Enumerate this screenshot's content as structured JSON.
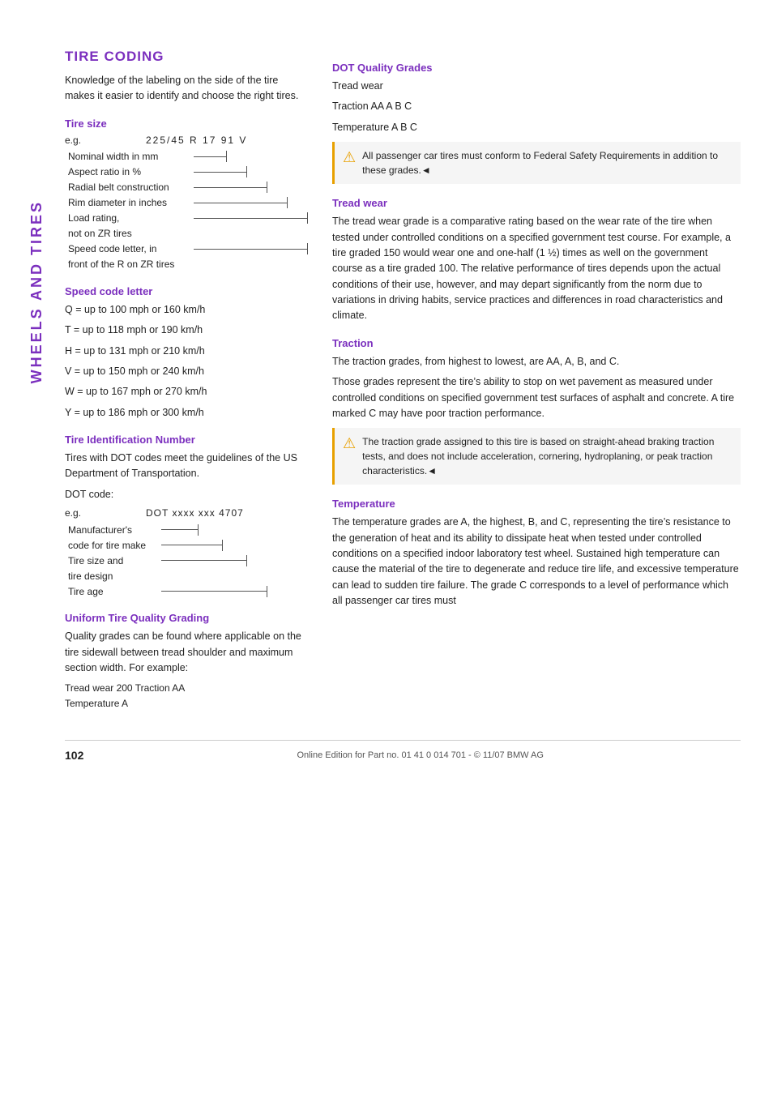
{
  "sidebar": {
    "label": "WHEELS AND TIRES"
  },
  "header": {
    "title": "TIRE CODING"
  },
  "intro": {
    "text": "Knowledge of the labeling on the side of the tire makes it easier to identify and choose the right tires."
  },
  "tire_size": {
    "title": "Tire size",
    "eg_label": "e.g.",
    "code": "225/45  R 17  91  V",
    "rows": [
      {
        "label": "Nominal width in mm",
        "lines": 1
      },
      {
        "label": "Aspect ratio in %",
        "lines": 2
      },
      {
        "label": "Radial belt construction",
        "lines": 3
      },
      {
        "label": "Rim diameter in inches",
        "lines": 4
      },
      {
        "label": "Load rating,",
        "lines": 5
      },
      {
        "label": "not on ZR tires",
        "lines": 5
      },
      {
        "label": "Speed code letter, in",
        "lines": 6
      },
      {
        "label": "front of the R on ZR tires",
        "lines": 6
      }
    ]
  },
  "speed_code": {
    "title": "Speed code letter",
    "items": [
      "Q = up to 100 mph or 160 km/h",
      "T = up to 118 mph or 190 km/h",
      "H = up to 131 mph or 210 km/h",
      "V = up to 150 mph or 240 km/h",
      "W = up to 167 mph or 270 km/h",
      "Y = up to 186 mph or 300 km/h"
    ]
  },
  "tire_id": {
    "title": "Tire Identification Number",
    "text1": "Tires with DOT codes meet the guidelines of the US Department of Transportation.",
    "dot_code_label": "DOT code:",
    "eg_label": "e.g.",
    "dot_code": "DOT xxxx xxx 4707",
    "dot_rows": [
      "Manufacturer’s",
      "code for tire make",
      "Tire size and",
      "tire design",
      "Tire age"
    ]
  },
  "uniform_tq": {
    "title": "Uniform Tire Quality Grading",
    "text": "Quality grades can be found where applicable on the tire sidewall between tread shoulder and maximum section width. For example:",
    "example": "Tread wear 200 Traction AA\nTemperature A"
  },
  "dot_quality": {
    "title": "DOT Quality Grades",
    "lines": [
      "Tread wear",
      "Traction AA A B C",
      "Temperature A B C"
    ],
    "warning": "All passenger car tires must conform to Federal Safety Requirements in addition to these grades.◄"
  },
  "tread_wear": {
    "title": "Tread wear",
    "text": "The tread wear grade is a comparative rating based on the wear rate of the tire when tested under controlled conditions on a specified government test course. For example, a tire graded 150 would wear one and one-half (1 ½) times as well on the government course as a tire graded 100. The relative performance of tires depends upon the actual conditions of their use, however, and may depart significantly from the norm due to variations in driving habits, service practices and differences in road characteristics and climate."
  },
  "traction": {
    "title": "Traction",
    "text1": "The traction grades, from highest to lowest, are AA, A, B, and C.",
    "text2": "Those grades represent the tire’s ability to stop on wet pavement as measured under controlled conditions on specified government test surfaces of asphalt and concrete. A tire marked C may have poor traction performance.",
    "warning": "The traction grade assigned to this tire is based on straight-ahead braking traction tests, and does not include acceleration, cornering, hydroplaning, or peak traction characteristics.◄"
  },
  "temperature": {
    "title": "Temperature",
    "text": "The temperature grades are A, the highest, B, and C, representing the tire’s resistance to the generation of heat and its ability to dissipate heat when tested under controlled conditions on a specified indoor laboratory test wheel. Sustained high temperature can cause the material of the tire to degenerate and reduce tire life, and excessive temperature can lead to sudden tire failure. The grade C corresponds to a level of performance which all passenger car tires must"
  },
  "footer": {
    "page_number": "102",
    "text": "Online Edition for Part no. 01 41 0 014 701 - © 11/07 BMW AG"
  }
}
